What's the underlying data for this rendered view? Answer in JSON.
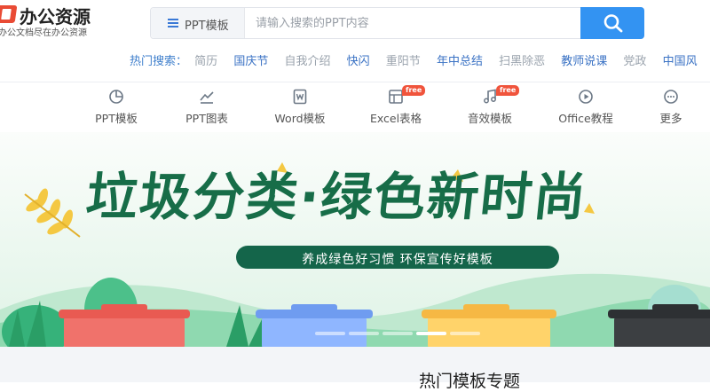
{
  "logo": {
    "title": "办公资源",
    "subtitle": "办公文档尽在办公资源"
  },
  "search": {
    "category_label": "PPT模板",
    "placeholder": "请输入搜索的PPT内容"
  },
  "hot_search": {
    "label": "热门搜索：",
    "keywords": [
      {
        "text": "简历",
        "style": "gray"
      },
      {
        "text": "国庆节",
        "style": "blue"
      },
      {
        "text": "自我介绍",
        "style": "gray"
      },
      {
        "text": "快闪",
        "style": "blue"
      },
      {
        "text": "重阳节",
        "style": "gray"
      },
      {
        "text": "年中总结",
        "style": "blue"
      },
      {
        "text": "扫黑除恶",
        "style": "gray"
      },
      {
        "text": "教师说课",
        "style": "blue"
      },
      {
        "text": "党政",
        "style": "gray"
      },
      {
        "text": "中国风",
        "style": "blue"
      }
    ]
  },
  "nav": {
    "items": [
      {
        "label": "PPT模板",
        "icon": "pie-chart-icon"
      },
      {
        "label": "PPT图表",
        "icon": "line-chart-icon"
      },
      {
        "label": "Word模板",
        "icon": "word-doc-icon"
      },
      {
        "label": "Excel表格",
        "icon": "spreadsheet-icon",
        "badge": "free"
      },
      {
        "label": "音效模板",
        "icon": "music-note-icon",
        "badge": "free"
      },
      {
        "label": "Office教程",
        "icon": "play-circle-icon"
      },
      {
        "label": "更多",
        "icon": "more-dots-icon"
      }
    ]
  },
  "banner": {
    "title": "垃圾分类·绿色新时尚",
    "subtitle": "养成绿色好习惯  环保宣传好模板",
    "slides": 5,
    "active_slide": 4
  },
  "section": {
    "title": "热门模板专题"
  },
  "colors": {
    "accent": "#3393f2",
    "link_blue": "#3a72c4",
    "banner_green": "#176d48",
    "badge_red": "#f0543c"
  }
}
